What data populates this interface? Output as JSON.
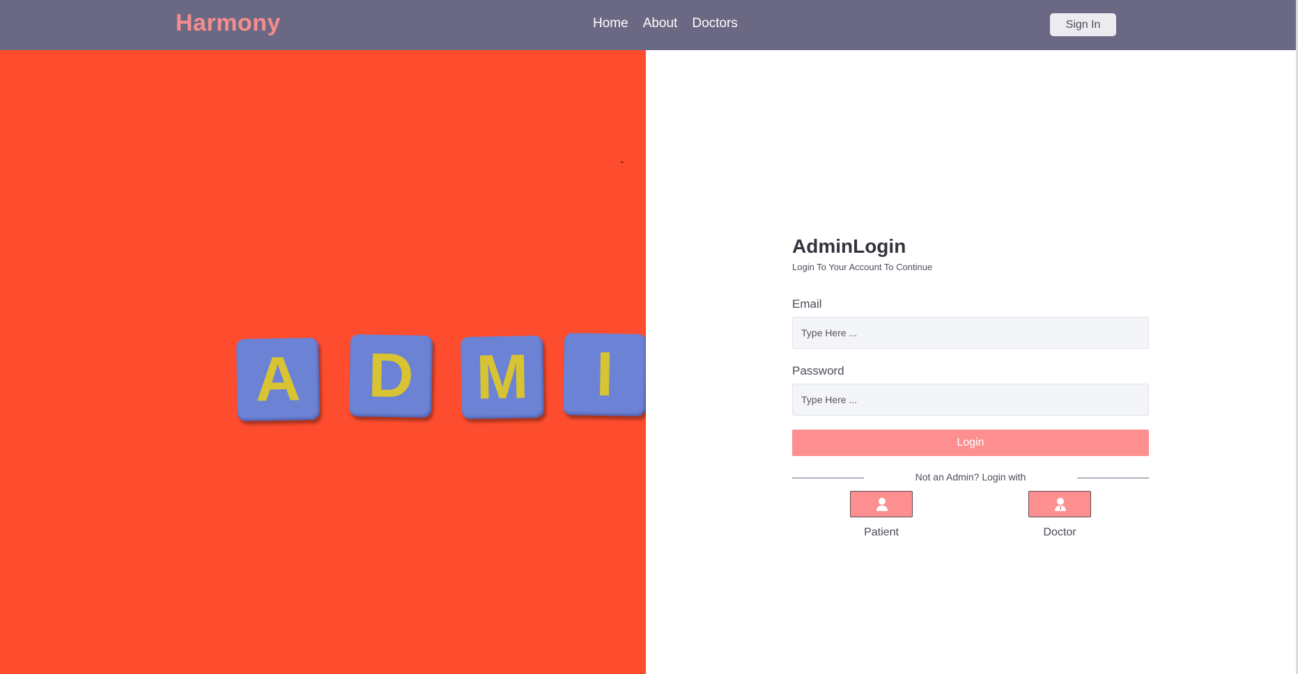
{
  "navbar": {
    "brand": "Harmony",
    "links": [
      "Home",
      "About",
      "Doctors"
    ],
    "signin_label": "Sign In"
  },
  "hero": {
    "tiles": [
      "A",
      "D",
      "M",
      "I"
    ]
  },
  "login": {
    "title": "AdminLogin",
    "subtitle": "Login To Your Account To Continue",
    "email_label": "Email",
    "email_placeholder": "Type Here ...",
    "password_label": "Password",
    "password_placeholder": "Type Here ...",
    "button_label": "Login",
    "divider_text": "Not an Admin? Login with",
    "alternatives": [
      {
        "label": "Patient",
        "icon": "user-icon"
      },
      {
        "label": "Doctor",
        "icon": "doctor-icon"
      }
    ]
  },
  "colors": {
    "navbar_bg": "#6b6883",
    "brand": "#f48d8d",
    "accent": "#fd8f90",
    "hero_bg": "#fd4d2e",
    "tile": "#6c82d4",
    "tile_letter": "#d8c432"
  }
}
